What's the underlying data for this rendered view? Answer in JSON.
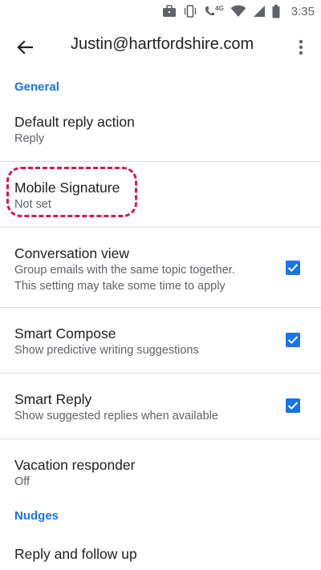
{
  "status_bar": {
    "time": "3:35",
    "network": "4G"
  },
  "toolbar": {
    "title": "Justin@hartfordshire.com"
  },
  "sections": {
    "general": "General",
    "nudges": "Nudges"
  },
  "settings": {
    "default_reply": {
      "title": "Default reply action",
      "subtitle": "Reply"
    },
    "mobile_signature": {
      "title": "Mobile Signature",
      "subtitle": "Not set"
    },
    "conversation_view": {
      "title": "Conversation view",
      "subtitle_line1": "Group emails with the same topic together.",
      "subtitle_line2": "This setting may take some time to apply",
      "checked": true
    },
    "smart_compose": {
      "title": "Smart Compose",
      "subtitle": "Show predictive writing suggestions",
      "checked": true
    },
    "smart_reply": {
      "title": "Smart Reply",
      "subtitle": "Show suggested replies when available",
      "checked": true
    },
    "vacation_responder": {
      "title": "Vacation responder",
      "subtitle": "Off"
    },
    "reply_follow_up": {
      "title": "Reply and follow up"
    }
  },
  "colors": {
    "accent": "#1a73e8",
    "highlight": "#d6175d",
    "divider": "#dadce0"
  }
}
